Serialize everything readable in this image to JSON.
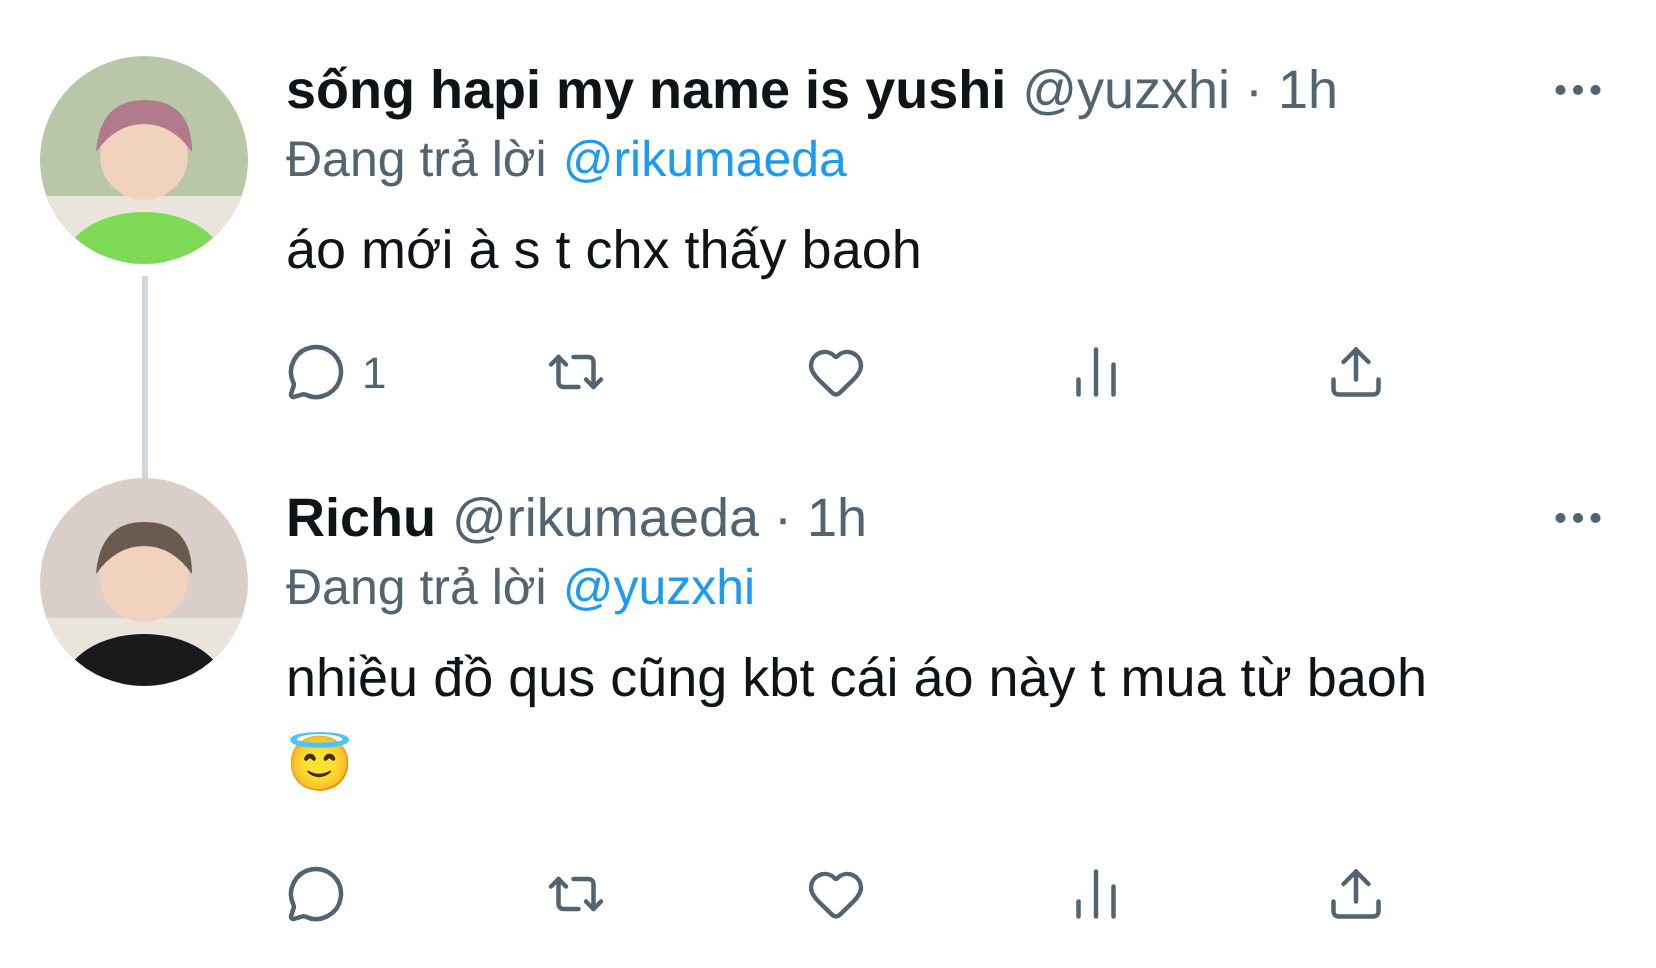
{
  "tweets": [
    {
      "display_name": "sống hapi my name is yushi",
      "meta": "@yuzxhi · 1h",
      "reply_prefix": "Đang trả lời",
      "reply_to": "@rikumaeda",
      "text": "áo mới à s t chx thấy baoh",
      "thread_line": true,
      "actions": [
        {
          "kind": "reply",
          "count": "1"
        },
        {
          "kind": "retweet"
        },
        {
          "kind": "like"
        },
        {
          "kind": "views"
        },
        {
          "kind": "share"
        }
      ]
    },
    {
      "display_name": "Richu",
      "meta": "@rikumaeda · 1h",
      "reply_prefix": "Đang trả lời",
      "reply_to": "@yuzxhi",
      "text": "nhiều đồ qus cũng kbt cái áo này t mua từ baoh 😇",
      "thread_line": false,
      "actions": [
        {
          "kind": "reply"
        },
        {
          "kind": "retweet"
        },
        {
          "kind": "like"
        },
        {
          "kind": "views"
        },
        {
          "kind": "share"
        }
      ]
    }
  ]
}
